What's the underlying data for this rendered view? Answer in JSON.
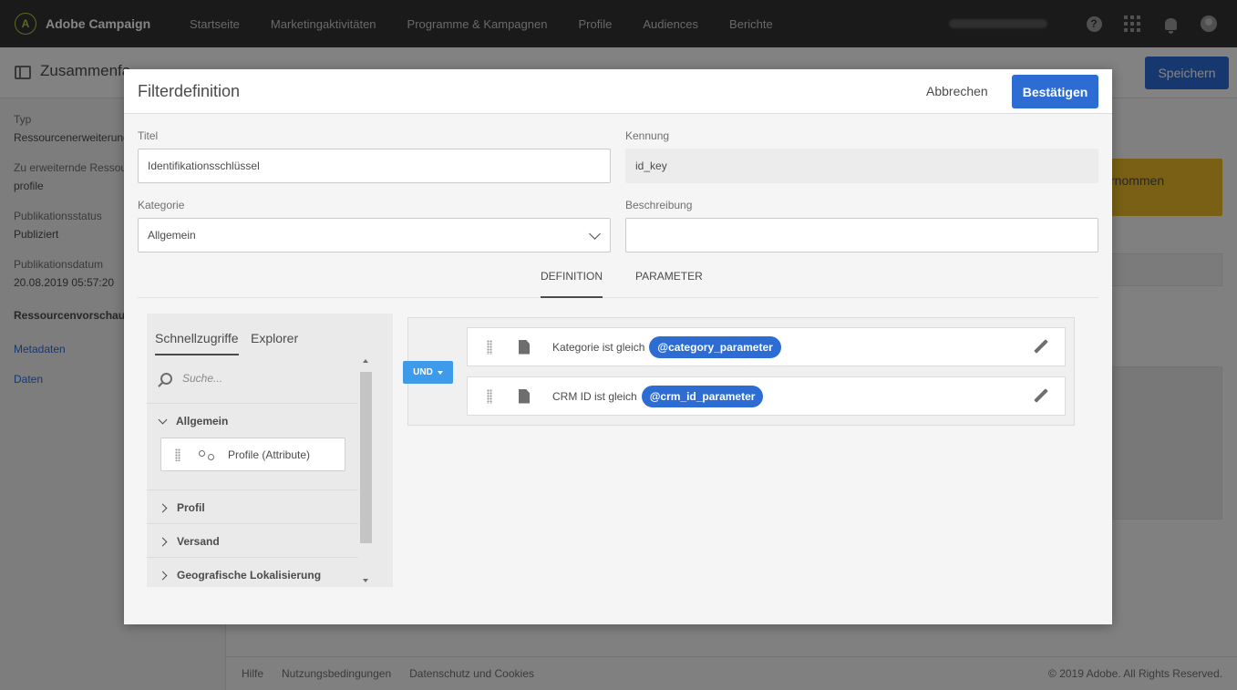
{
  "topbar": {
    "brand": "Adobe Campaign",
    "logo_letter": "A",
    "nav": [
      "Startseite",
      "Marketingaktivitäten",
      "Programme & Kampagnen",
      "Profile",
      "Audiences",
      "Berichte"
    ],
    "help_label": "?"
  },
  "background": {
    "title": "Zusammenfa",
    "save_label": "Speichern",
    "sidebar": {
      "typ_label": "Typ",
      "typ_value": "Ressourcenerweiterung",
      "ext_label": "Zu erweiternde Ressou",
      "ext_value": "profile",
      "status_label": "Publikationsstatus",
      "status_value": "Publiziert",
      "date_label": "Publikationsdatum",
      "date_value": "20.08.2019 05:57:20",
      "preview_section": "Ressourcenvorschau",
      "links": [
        "Metadaten",
        "Daten"
      ]
    },
    "warning_text": "rnommen",
    "footer": {
      "links": [
        "Hilfe",
        "Nutzungsbedingungen",
        "Datenschutz und Cookies"
      ],
      "copyright": "© 2019 Adobe. All Rights Reserved."
    }
  },
  "modal": {
    "title": "Filterdefinition",
    "cancel_label": "Abbrechen",
    "confirm_label": "Bestätigen",
    "fields": {
      "titel_label": "Titel",
      "titel_value": "Identifikationsschlüssel",
      "kennung_label": "Kennung",
      "kennung_value": "id_key",
      "kategorie_label": "Kategorie",
      "kategorie_value": "Allgemein",
      "beschreibung_label": "Beschreibung",
      "beschreibung_value": ""
    },
    "tabs": [
      "DEFINITION",
      "PARAMETER"
    ],
    "palette": {
      "tabs": [
        "Schnellzugriffe",
        "Explorer"
      ],
      "search_placeholder": "Suche...",
      "open_group": "Allgemein",
      "open_group_item": "Profile (Attribute)",
      "groups": [
        "Profil",
        "Versand",
        "Geografische Lokalisierung"
      ]
    },
    "query": {
      "operator": "UND",
      "conditions": [
        {
          "text": "Kategorie ist gleich",
          "param": "@category_parameter"
        },
        {
          "text": "CRM ID ist gleich",
          "param": "@crm_id_parameter"
        }
      ]
    }
  },
  "colors": {
    "primary": "#2d6cd3",
    "operator": "#3d9be9",
    "warning": "#e9b829",
    "topbar": "#323232"
  }
}
